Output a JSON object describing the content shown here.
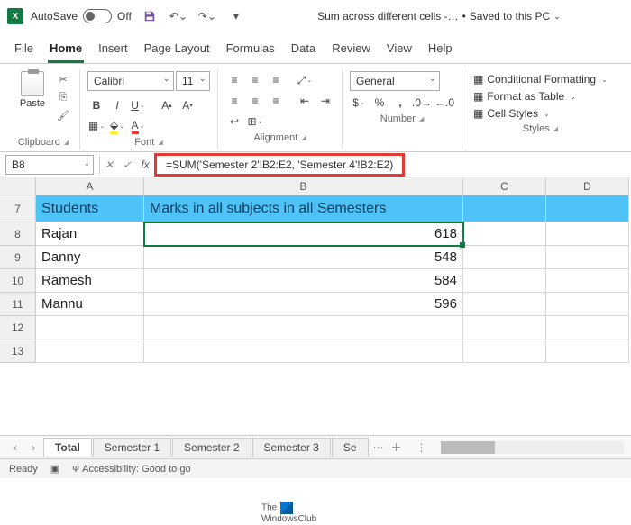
{
  "titlebar": {
    "autosave_label": "AutoSave",
    "autosave_state": "Off",
    "doc_name": "Sum across different cells -…",
    "save_status": "Saved to this PC"
  },
  "tabs": [
    "File",
    "Home",
    "Insert",
    "Page Layout",
    "Formulas",
    "Data",
    "Review",
    "View",
    "Help"
  ],
  "active_tab": "Home",
  "ribbon": {
    "clipboard_label": "Clipboard",
    "paste_label": "Paste",
    "font_name": "Calibri",
    "font_size": "11",
    "font_label": "Font",
    "alignment_label": "Alignment",
    "number_format": "General",
    "number_label": "Number",
    "styles_label": "Styles",
    "cond_fmt": "Conditional Formatting",
    "fmt_table": "Format as Table",
    "cell_styles": "Cell Styles"
  },
  "namebox": "B8",
  "formula": "=SUM('Semester 2'!B2:E2, 'Semester 4'!B2:E2)",
  "columns": [
    "A",
    "B",
    "C",
    "D"
  ],
  "rows": [
    {
      "n": "7",
      "a": "Students",
      "b": "Marks in all subjects in all Semesters",
      "header": true
    },
    {
      "n": "8",
      "a": "Rajan",
      "b": "618",
      "active": true
    },
    {
      "n": "9",
      "a": "Danny",
      "b": "548"
    },
    {
      "n": "10",
      "a": "Ramesh",
      "b": "584"
    },
    {
      "n": "11",
      "a": "Mannu",
      "b": "596"
    },
    {
      "n": "12",
      "a": "",
      "b": ""
    },
    {
      "n": "13",
      "a": "",
      "b": ""
    }
  ],
  "watermark": {
    "line1": "The",
    "line2": "WindowsClub"
  },
  "sheets": [
    "Total",
    "Semester 1",
    "Semester 2",
    "Semester 3",
    "Se"
  ],
  "active_sheet": "Total",
  "status": {
    "ready": "Ready",
    "access": "Accessibility: Good to go"
  }
}
